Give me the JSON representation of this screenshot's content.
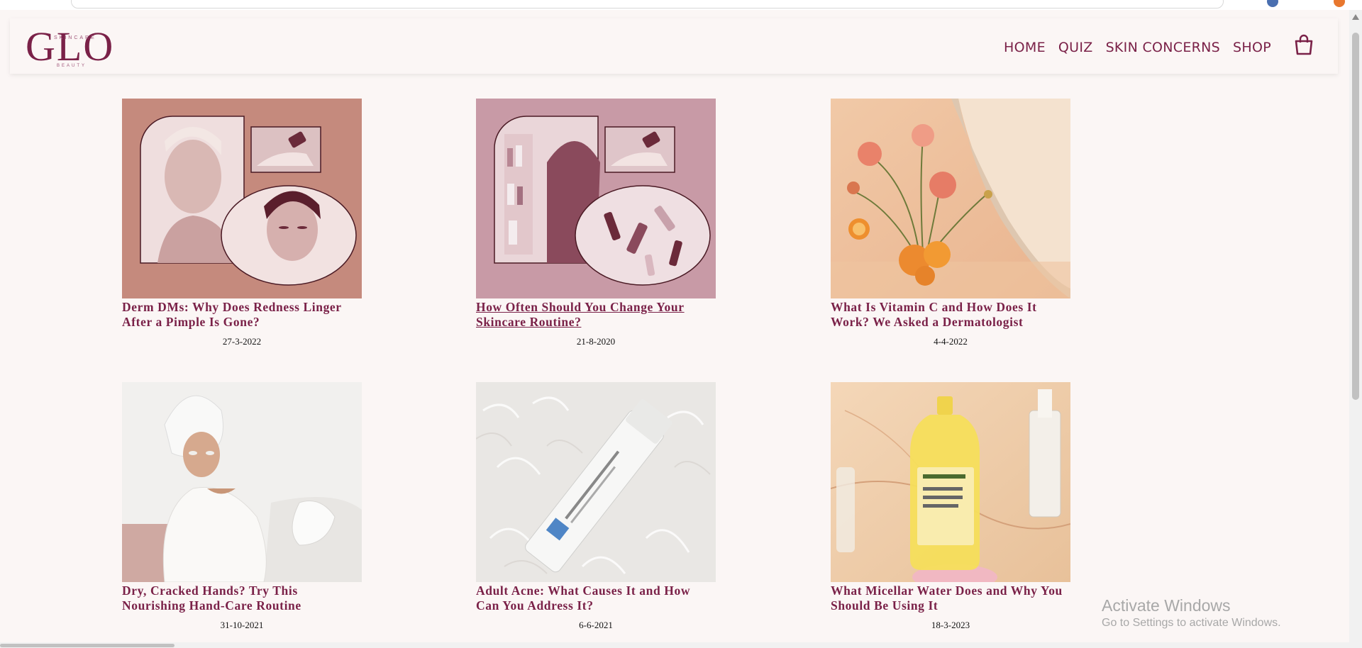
{
  "brand": {
    "logo_text": "GLO",
    "logo_top": "SKINCARE",
    "logo_bottom": "BEAUTY",
    "color": "#7a2148"
  },
  "nav": {
    "items": [
      {
        "label": "HOME"
      },
      {
        "label": "QUIZ"
      },
      {
        "label": "SKIN CONCERNS"
      },
      {
        "label": "SHOP"
      }
    ],
    "cart_icon": "shopping-bag-icon"
  },
  "articles": [
    {
      "title": "Derm DMs: Why Does Redness Linger After a Pimple Is Gone?",
      "date": "27-3-2022",
      "image": "redness-collage-image"
    },
    {
      "title": "How Often Should You Change Your Skincare Routine?",
      "date": "21-8-2020",
      "image": "skincare-routine-collage-image"
    },
    {
      "title": "What Is Vitamin C and How Does It Work? We Asked a Dermatologist",
      "date": "4-4-2022",
      "image": "oranges-roses-image"
    },
    {
      "title": "Dry, Cracked Hands? Try This Nourishing Hand-Care Routine",
      "date": "31-10-2021",
      "image": "hand-care-woman-image"
    },
    {
      "title": "Adult Acne: What Causes It and How Can You Address It?",
      "date": "6-6-2021",
      "image": "acne-cream-tube-image"
    },
    {
      "title": "What Micellar Water Does and Why You Should Be Using It",
      "date": "18-3-2023",
      "image": "micellar-water-bottle-image"
    }
  ],
  "watermark": {
    "title": "Activate Windows",
    "subtitle": "Go to Settings to activate Windows."
  },
  "colors": {
    "background": "#fbf6f5",
    "accent": "#7a2148"
  }
}
